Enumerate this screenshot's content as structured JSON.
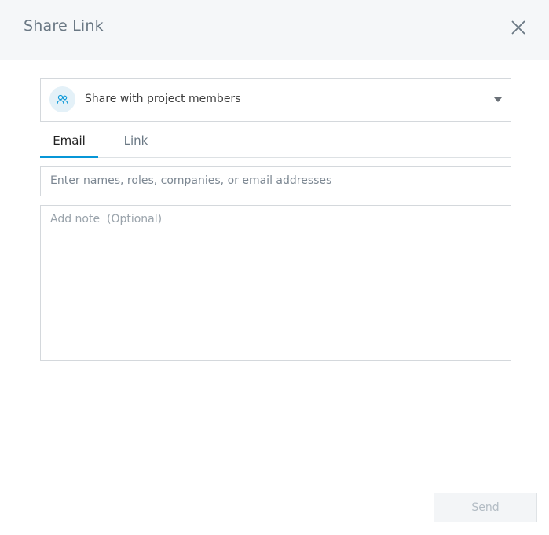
{
  "dialog": {
    "title": "Share Link",
    "close_icon": "close-icon"
  },
  "share_scope": {
    "icon": "users-icon",
    "selected": "Share with project members",
    "caret_icon": "caret-down-icon"
  },
  "tabs": [
    {
      "label": "Email",
      "active": true
    },
    {
      "label": "Link",
      "active": false
    }
  ],
  "recipients": {
    "value": "",
    "placeholder": "Enter names, roles, companies, or email addresses"
  },
  "note": {
    "value": "",
    "placeholder": "Add note  (Optional)"
  },
  "footer": {
    "send_label": "Send",
    "send_enabled": false
  },
  "colors": {
    "accent": "#0696d7",
    "header_bg": "#f5f7f9",
    "border": "#d4d8dc"
  }
}
